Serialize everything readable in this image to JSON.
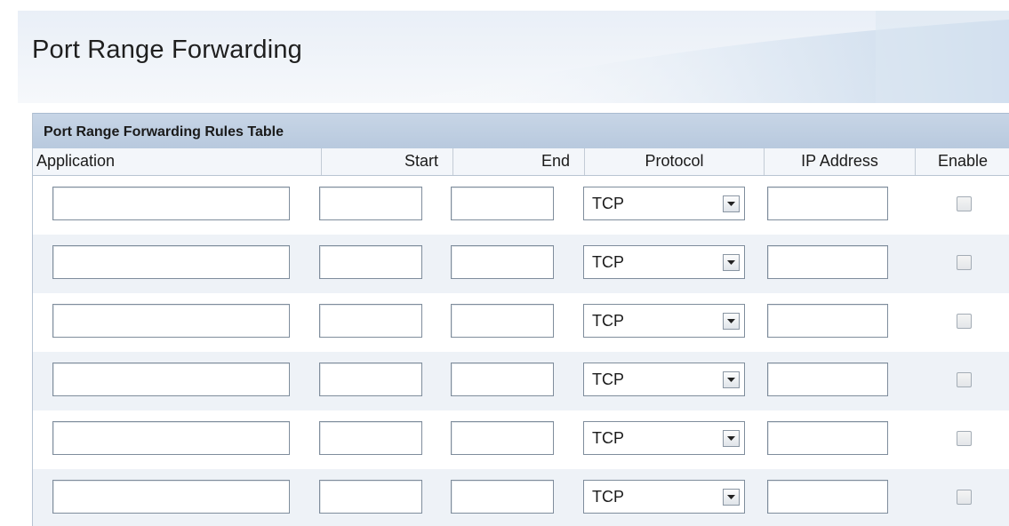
{
  "page": {
    "title": "Port Range Forwarding"
  },
  "table": {
    "caption": "Port Range Forwarding Rules Table",
    "columns": [
      "Application",
      "Start",
      "End",
      "Protocol",
      "IP Address",
      "Enable"
    ],
    "rows": [
      {
        "application": "",
        "start": "",
        "end": "",
        "protocol": "TCP",
        "ip_address": "",
        "enabled": false
      },
      {
        "application": "",
        "start": "",
        "end": "",
        "protocol": "TCP",
        "ip_address": "",
        "enabled": false
      },
      {
        "application": "",
        "start": "",
        "end": "",
        "protocol": "TCP",
        "ip_address": "",
        "enabled": false
      },
      {
        "application": "",
        "start": "",
        "end": "",
        "protocol": "TCP",
        "ip_address": "",
        "enabled": false
      },
      {
        "application": "",
        "start": "",
        "end": "",
        "protocol": "TCP",
        "ip_address": "",
        "enabled": false
      },
      {
        "application": "",
        "start": "",
        "end": "",
        "protocol": "TCP",
        "ip_address": "",
        "enabled": false
      }
    ]
  },
  "colors": {
    "caption_bar": "#bccbe0",
    "row_alt": "#eef2f7",
    "banner": "#e9eff7"
  },
  "icons": {
    "dropdown": "chevron-down-icon",
    "checkbox": "checkbox-unchecked-icon"
  }
}
